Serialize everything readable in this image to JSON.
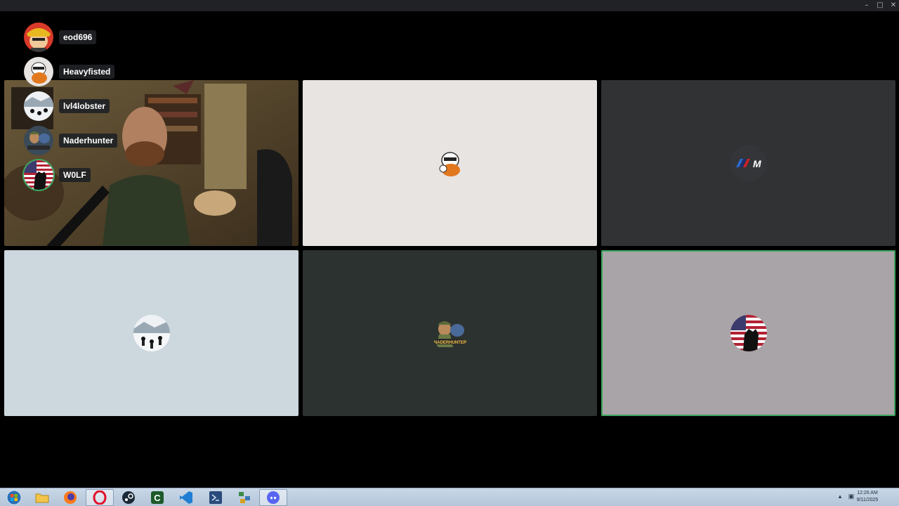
{
  "window": {
    "title": "",
    "controls": {
      "minimize": "–",
      "maximize": "□",
      "close": "✕"
    }
  },
  "voice_overlay": {
    "users": [
      {
        "name": "eod696",
        "avatar": "cartoon-hat-avatar",
        "speaking": false
      },
      {
        "name": "Heavyfisted",
        "avatar": "cartoon-bird-avatar",
        "speaking": false
      },
      {
        "name": "lvl4lobster",
        "avatar": "winter-scene-avatar",
        "speaking": false
      },
      {
        "name": "Naderhunter",
        "avatar": "soldier-badge-avatar",
        "speaking": false
      },
      {
        "name": "W0LF",
        "avatar": "flag-silhouette-avatar",
        "speaking": true
      }
    ]
  },
  "grid": {
    "tiles": [
      {
        "type": "camera",
        "avatar": "webcam-feed",
        "bg": "#5a4a30",
        "speaking": false
      },
      {
        "type": "avatar",
        "avatar": "cartoon-bird-avatar",
        "bg": "#e8e4e2",
        "speaking": false
      },
      {
        "type": "avatar",
        "avatar": "bmw-m-logo-avatar",
        "bg": "#303234",
        "speaking": false
      },
      {
        "type": "avatar",
        "avatar": "winter-scene-avatar",
        "bg": "#cdd7de",
        "speaking": false
      },
      {
        "type": "avatar",
        "avatar": "soldier-badge-avatar",
        "bg": "#2c3230",
        "speaking": false
      },
      {
        "type": "avatar",
        "avatar": "flag-silhouette-avatar",
        "bg": "#a8a4a8",
        "speaking": true
      }
    ]
  },
  "taskbar": {
    "apps": [
      {
        "name": "start-button",
        "icon": "windows-orb-icon"
      },
      {
        "name": "file-explorer",
        "icon": "folder-icon"
      },
      {
        "name": "firefox",
        "icon": "firefox-icon"
      },
      {
        "name": "opera",
        "icon": "opera-icon",
        "active": true
      },
      {
        "name": "steam",
        "icon": "steam-icon"
      },
      {
        "name": "app-c",
        "icon": "c-app-icon"
      },
      {
        "name": "vscode",
        "icon": "vscode-icon"
      },
      {
        "name": "visual-studio",
        "icon": "visual-studio-icon"
      },
      {
        "name": "network-tool",
        "icon": "network-icon"
      },
      {
        "name": "discord",
        "icon": "discord-icon",
        "active": true
      }
    ],
    "tray": {
      "time": "12:26 AM",
      "date": "9/11/2025"
    }
  },
  "colors": {
    "speaking_ring": "#3ba55c",
    "overlay_label_bg": "#202225",
    "taskbar_bg": "#c0d0e2"
  }
}
